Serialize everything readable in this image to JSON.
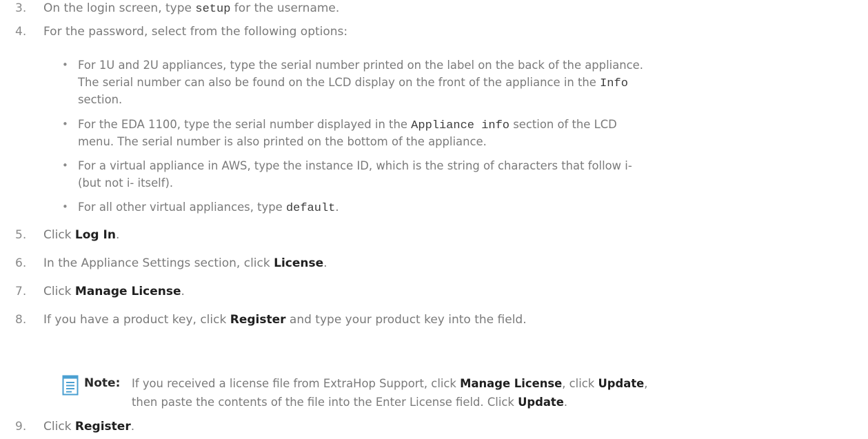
{
  "steps": [
    {
      "num": "3.",
      "pre": "On the login screen, type ",
      "code": "setup",
      "post": " for the username."
    },
    {
      "num": "4.",
      "text": "For the password, select from the following options:"
    },
    {
      "num": "5.",
      "pre": "Click ",
      "bold": "Log In",
      "post": "."
    },
    {
      "num": "6.",
      "pre": "In the Appliance Settings section, click ",
      "bold": "License",
      "post": "."
    },
    {
      "num": "7.",
      "pre": "Click ",
      "bold": "Manage License",
      "post": "."
    },
    {
      "num": "8.",
      "pre": "If you have a product key, click ",
      "bold": "Register",
      "post": " and type your product key into the field."
    },
    {
      "num": "9.",
      "pre": "Click ",
      "bold": "Register",
      "post": "."
    }
  ],
  "bullets": [
    {
      "line1": "For 1U and 2U appliances, type the serial number printed on the label on the back of the appliance.",
      "line2_pre": "The serial number can also be found on the LCD display on the front of the appliance in the ",
      "line2_code": "Info",
      "line3": "section."
    },
    {
      "line1_pre": "For the EDA 1100, type the serial number displayed in the ",
      "line1_code": "Appliance info",
      "line1_post": " section of the LCD",
      "line2": "menu. The serial number is also printed on the bottom of the appliance."
    },
    {
      "line1": "For a virtual appliance in AWS, type the instance ID, which is the string of characters that follow i-",
      "line2": "(but not i- itself)."
    },
    {
      "pre": "For all other virtual appliances, type ",
      "code": "default",
      "post": "."
    }
  ],
  "note": {
    "label": "Note:",
    "l1_a": "If you received a license file from ExtraHop Support, click ",
    "l1_b": "Manage License",
    "l1_c": ", click ",
    "l1_d": "Update",
    "l1_e": ",",
    "l2_a": "then paste the contents of the file into the Enter License field. Click ",
    "l2_b": "Update",
    "l2_c": "."
  },
  "colors": {
    "text": "#7a7a7a",
    "bold": "#1f1f1f",
    "note_icon": "#4a9fd1"
  }
}
